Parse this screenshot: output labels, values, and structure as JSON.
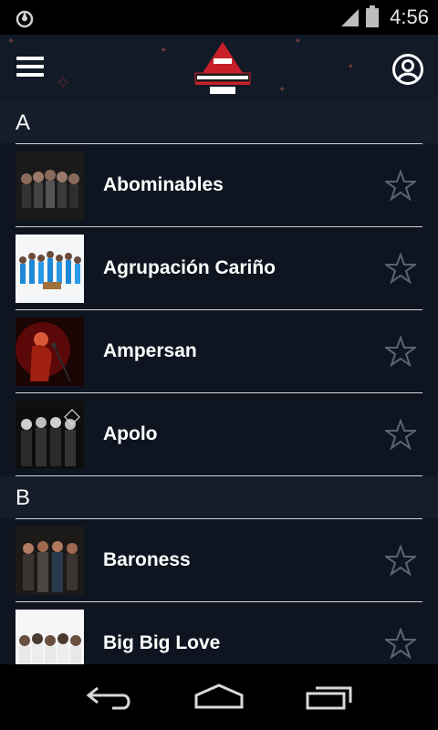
{
  "status_bar": {
    "time": "4:56"
  },
  "header": {
    "logo_alt": "VIVE LATINO 2016"
  },
  "sections": [
    {
      "letter": "A",
      "artists": [
        {
          "name": "Abominables"
        },
        {
          "name": "Agrupación Cariño"
        },
        {
          "name": "Ampersan"
        },
        {
          "name": "Apolo"
        }
      ]
    },
    {
      "letter": "B",
      "artists": [
        {
          "name": "Baroness"
        },
        {
          "name": "Big Big Love"
        }
      ]
    }
  ],
  "colors": {
    "background": "#0f1520",
    "header": "#111a26",
    "section": "#141d29",
    "logo_red": "#c8202a"
  },
  "icons": [
    "menu-icon",
    "profile-icon",
    "star-outline-icon",
    "back-icon",
    "home-icon",
    "recent-apps-icon"
  ]
}
